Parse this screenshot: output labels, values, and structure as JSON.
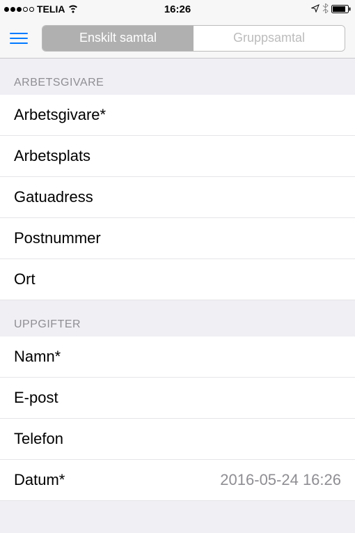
{
  "status": {
    "carrier": "TELIA",
    "time": "16:26"
  },
  "nav": {
    "segments": [
      "Enskilt samtal",
      "Gruppsamtal"
    ]
  },
  "sections": [
    {
      "header": "ARBETSGIVARE",
      "rows": [
        {
          "placeholder": "Arbetsgivare*"
        },
        {
          "placeholder": "Arbetsplats"
        },
        {
          "placeholder": "Gatuadress"
        },
        {
          "placeholder": "Postnummer"
        },
        {
          "placeholder": "Ort"
        }
      ]
    },
    {
      "header": "UPPGIFTER",
      "rows": [
        {
          "placeholder": "Namn*"
        },
        {
          "placeholder": "E-post"
        },
        {
          "placeholder": "Telefon"
        },
        {
          "label": "Datum*",
          "value": "2016-05-24 16:26"
        }
      ]
    }
  ]
}
